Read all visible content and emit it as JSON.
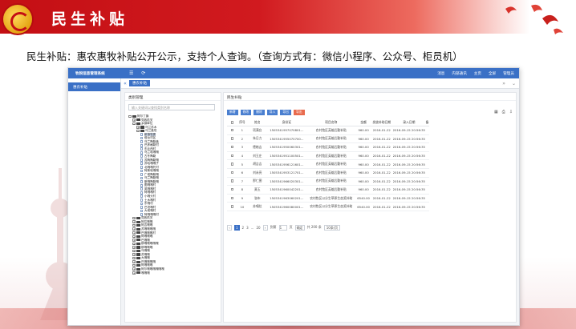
{
  "slide": {
    "title": "民生补贴",
    "subtitle": "民生补贴：惠农惠牧补贴公开公示，支持个人查询。（查询方式有：微信小程序、公众号、柜员机）"
  },
  "app": {
    "brand": "牧税信息管理系统",
    "topbar": [
      "消息",
      "内部通讯",
      "主页",
      "全屏",
      "管理员"
    ],
    "sidebar_item": "惠农补贴",
    "tab": "惠农补贴",
    "tree_panel": {
      "title": "类别管理",
      "search_placeholder": "输入关键词以查找类别名称",
      "nodes": [
        {
          "label": "阿尔丁旗",
          "level": 0,
          "open": true
        },
        {
          "label": "党政机关",
          "level": 1,
          "open": false
        },
        {
          "label": "乡镇单位",
          "level": 1,
          "open": true
        },
        {
          "label": "乌兰苏木",
          "level": 2,
          "open": false
        },
        {
          "label": "马兰高坦",
          "level": 2,
          "open": true
        },
        {
          "label": "新镇牧委",
          "level": 3,
          "selected": true
        },
        {
          "label": "塔台村区",
          "level": 3
        },
        {
          "label": "乌兰陶勒盖",
          "level": 3
        },
        {
          "label": "巴彦格勒村",
          "level": 3
        },
        {
          "label": "东北西村",
          "level": 3
        },
        {
          "label": "乌兰哈嘎嘎",
          "level": 3
        },
        {
          "label": "古冬陶勒",
          "level": 3
        },
        {
          "label": "苏陶陶勒嘎",
          "level": 3
        },
        {
          "label": "苏哈嘎嘎子",
          "level": 3
        },
        {
          "label": "北嘎嘎托村",
          "level": 3
        },
        {
          "label": "阿斯哈嘎嘎",
          "level": 3
        },
        {
          "label": "广塔陶勒嘎",
          "level": 3
        },
        {
          "label": "乌兰陶勒嘎",
          "level": 3
        },
        {
          "label": "斯嘎陶勒嘎",
          "level": 3
        },
        {
          "label": "图嘎嘎村",
          "level": 3
        },
        {
          "label": "英嘎嘎村",
          "level": 3
        },
        {
          "label": "阿嘎嘎村",
          "level": 3
        },
        {
          "label": "小嘎头村",
          "level": 3
        },
        {
          "label": "土木嘎村",
          "level": 3
        },
        {
          "label": "东嘎村",
          "level": 3
        },
        {
          "label": "巴坦嘎村",
          "level": 3
        },
        {
          "label": "大塔嘎村",
          "level": 3
        },
        {
          "label": "阿嘎嘎嘎村",
          "level": 3
        },
        {
          "label": "党政机关",
          "level": 1,
          "open": false
        },
        {
          "label": "阿拉嘎嘎",
          "level": 1,
          "open": false
        },
        {
          "label": "阿吉嘎嘎",
          "level": 1,
          "open": false
        },
        {
          "label": "苏嘎嘎嘎嘎",
          "level": 1,
          "open": false
        },
        {
          "label": "巴嘎嘎嘎村",
          "level": 1,
          "open": false
        },
        {
          "label": "阿嘎嘎嘎",
          "level": 1,
          "open": false
        },
        {
          "label": "巴嘎嘎",
          "level": 1,
          "open": false
        },
        {
          "label": "那嘎嘎嘎嘎嘎",
          "level": 1,
          "open": false
        },
        {
          "label": "那嘎嘎嘎",
          "level": 1,
          "open": false
        },
        {
          "label": "乌嘎嘎",
          "level": 1,
          "open": false
        },
        {
          "label": "苏嘎嘎",
          "level": 1,
          "open": false
        },
        {
          "label": "大嘎嘎",
          "level": 1,
          "open": false
        },
        {
          "label": "巴嘎嘎嘎嘎",
          "level": 1,
          "open": false
        },
        {
          "label": "阿嘎嘎嘎",
          "level": 1,
          "open": false
        },
        {
          "label": "阿尔嘎嘎嘎嘎嘎嘎",
          "level": 1,
          "open": false
        },
        {
          "label": "嘎嘎嘎",
          "level": 1,
          "open": false
        }
      ]
    },
    "main_panel": {
      "title": "民生补贴",
      "buttons": [
        "新增",
        "修改",
        "删除",
        "导入",
        "导出",
        "导出"
      ],
      "columns": [
        "序号",
        "姓名",
        "身份证",
        "项目名称",
        "金额",
        "发放补助日期",
        "录入日期",
        "备"
      ],
      "rows": [
        [
          "1",
          "项满台",
          "1505341957070801...",
          "农村牧区英雄后勤补贴",
          "960.00",
          "2016-01-22",
          "2016-09-15 20:56:35",
          ""
        ],
        [
          "2",
          "朱日力",
          "1505341955070700...",
          "农村牧区英雄后勤补贴",
          "960.00",
          "2016-01-22",
          "2016-09-15 20:56:35",
          ""
        ],
        [
          "3",
          "德格吉",
          "1505341950060301...",
          "农村牧区英雄后勤补贴",
          "960.00",
          "2016-01-22",
          "2016-09-15 20:56:35",
          ""
        ],
        [
          "4",
          "刘玉庄",
          "1505341951100501...",
          "农村牧区英雄后勤补贴",
          "960.00",
          "2016-01-22",
          "2016-09-15 20:56:35",
          ""
        ],
        [
          "5",
          "胡吉吉",
          "1505341956121601...",
          "农村牧区英雄后勤补贴",
          "960.00",
          "2016-01-22",
          "2016-09-15 20:56:35",
          ""
        ],
        [
          "6",
          "刘永亮",
          "1505341953121701...",
          "农村牧区英雄后勤补贴",
          "960.00",
          "2016-01-22",
          "2016-09-15 20:56:35",
          ""
        ],
        [
          "7",
          "那仁图",
          "1505341966020301...",
          "农村牧区英雄后勤补贴",
          "960.00",
          "2016-01-22",
          "2016-09-15 20:56:35",
          ""
        ],
        [
          "8",
          "莫玉",
          "1505341960042201...",
          "农村牧区英雄后勤补贴",
          "960.00",
          "2016-01-22",
          "2016-09-15 20:56:35",
          ""
        ],
        [
          "9",
          "张布",
          "1505341963060201...",
          "农村牧区以分生草原生态奖补助",
          "6540.00",
          "2016-01-22",
          "2016-09-15 20:56:35",
          ""
        ],
        [
          "10",
          "苏嘎拉",
          "1505341960080001...",
          "农村牧区以分生草原生态奖补助",
          "6540.00",
          "2016-01-22",
          "2016-09-15 20:56:35",
          ""
        ]
      ],
      "pager": {
        "prev": "‹",
        "pages": [
          "1",
          "2",
          "3",
          "...",
          "20"
        ],
        "next": "›",
        "goto_label": "到第",
        "goto_value": "1",
        "page_unit": "页",
        "confirm": "确定",
        "total": "共 200 条",
        "size": "10条/页"
      }
    }
  }
}
